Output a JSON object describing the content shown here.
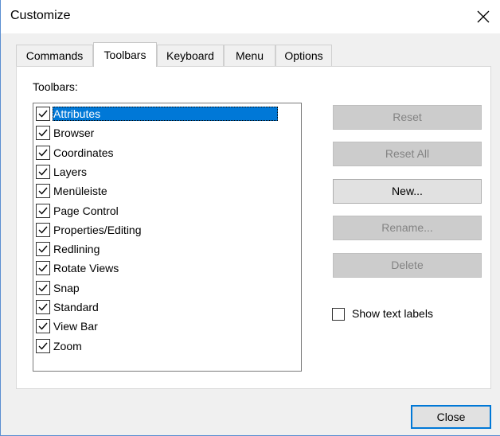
{
  "window": {
    "title": "Customize",
    "close_icon": "close-icon"
  },
  "tabs": [
    {
      "label": "Commands",
      "active": false
    },
    {
      "label": "Toolbars",
      "active": true
    },
    {
      "label": "Keyboard",
      "active": false
    },
    {
      "label": "Menu",
      "active": false
    },
    {
      "label": "Options",
      "active": false
    }
  ],
  "toolbars_panel": {
    "list_label": "Toolbars:",
    "items": [
      {
        "label": "Attributes",
        "checked": true,
        "selected": true
      },
      {
        "label": "Browser",
        "checked": true,
        "selected": false
      },
      {
        "label": "Coordinates",
        "checked": true,
        "selected": false
      },
      {
        "label": "Layers",
        "checked": true,
        "selected": false
      },
      {
        "label": "Menüleiste",
        "checked": true,
        "selected": false
      },
      {
        "label": "Page Control",
        "checked": true,
        "selected": false
      },
      {
        "label": "Properties/Editing",
        "checked": true,
        "selected": false
      },
      {
        "label": "Redlining",
        "checked": true,
        "selected": false
      },
      {
        "label": "Rotate Views",
        "checked": true,
        "selected": false
      },
      {
        "label": "Snap",
        "checked": true,
        "selected": false
      },
      {
        "label": "Standard",
        "checked": true,
        "selected": false
      },
      {
        "label": "View Bar",
        "checked": true,
        "selected": false
      },
      {
        "label": "Zoom",
        "checked": true,
        "selected": false
      }
    ],
    "buttons": {
      "reset": {
        "label": "Reset",
        "enabled": false
      },
      "reset_all": {
        "label": "Reset All",
        "enabled": false
      },
      "new": {
        "label": "New...",
        "enabled": true
      },
      "rename": {
        "label": "Rename...",
        "enabled": false
      },
      "delete": {
        "label": "Delete",
        "enabled": false
      }
    },
    "show_text_labels": {
      "label": "Show text labels",
      "checked": false
    }
  },
  "footer": {
    "close_label": "Close"
  },
  "colors": {
    "selection": "#0078d7",
    "dialog_bg": "#f0f0f0",
    "disabled_button_bg": "#cccccc"
  }
}
